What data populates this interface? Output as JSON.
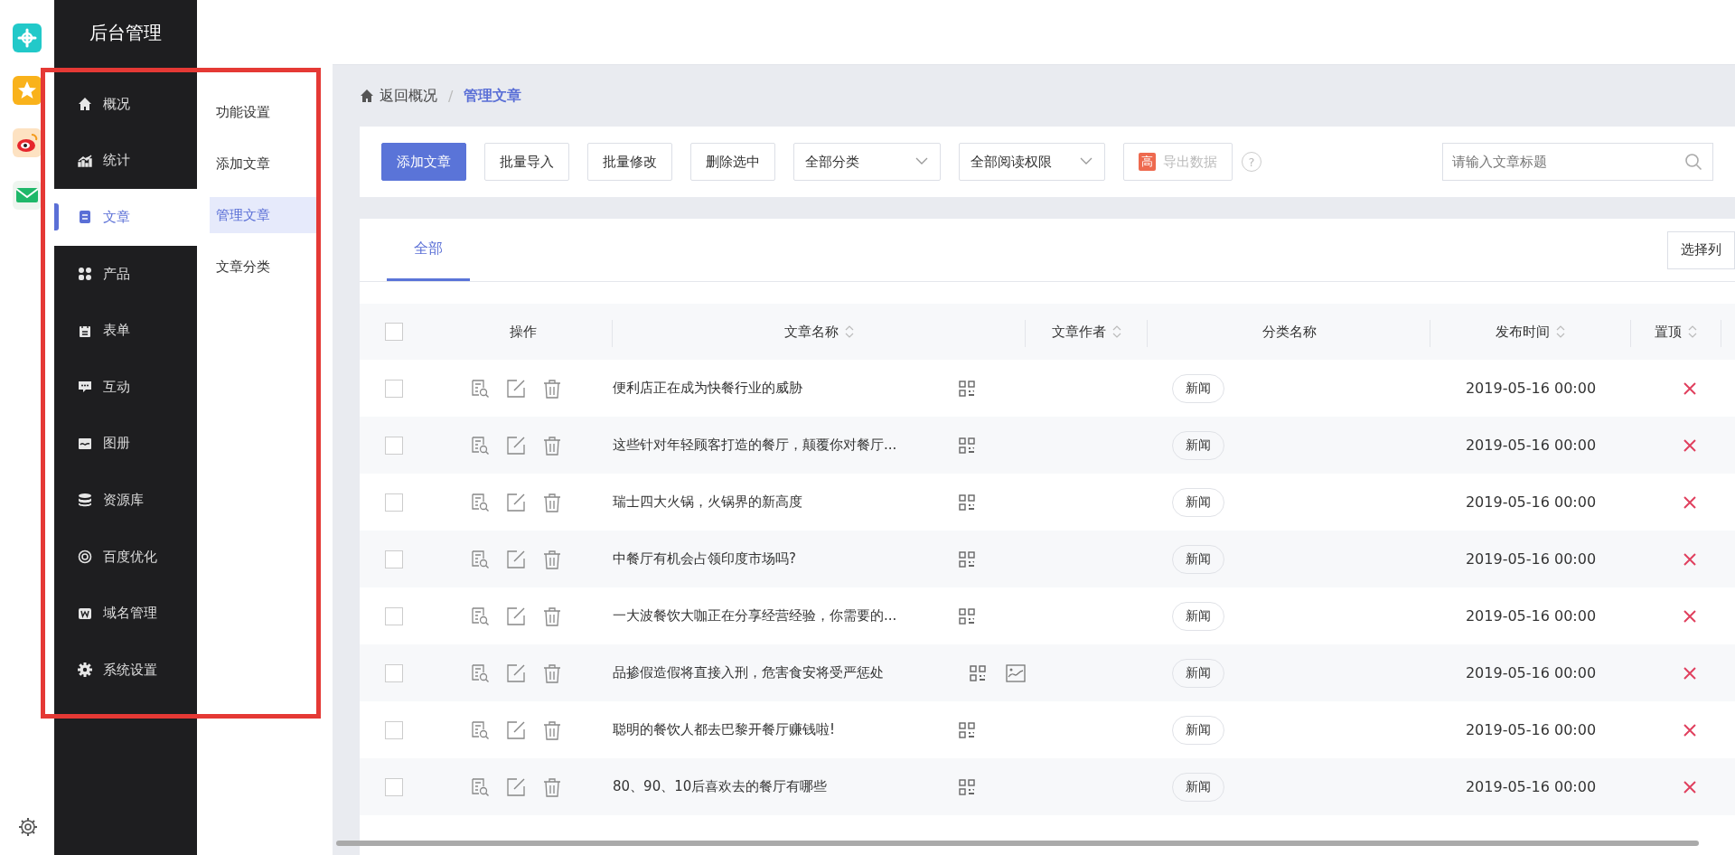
{
  "sidebar": {
    "title": "后台管理",
    "items": [
      {
        "label": "概况",
        "selected": false
      },
      {
        "label": "统计",
        "selected": false
      },
      {
        "label": "文章",
        "selected": true
      },
      {
        "label": "产品",
        "selected": false
      },
      {
        "label": "表单",
        "selected": false
      },
      {
        "label": "互动",
        "selected": false
      },
      {
        "label": "图册",
        "selected": false
      },
      {
        "label": "资源库",
        "selected": false
      },
      {
        "label": "百度优化",
        "selected": false
      },
      {
        "label": "域名管理",
        "selected": false
      },
      {
        "label": "系统设置",
        "selected": false
      }
    ]
  },
  "submenu": [
    {
      "label": "功能设置",
      "selected": false
    },
    {
      "label": "添加文章",
      "selected": false
    },
    {
      "label": "管理文章",
      "selected": true
    },
    {
      "label": "文章分类",
      "selected": false
    }
  ],
  "breadcrumb": {
    "separator": "/",
    "items": [
      {
        "label": "返回概况",
        "current": false
      },
      {
        "label": "管理文章",
        "current": true
      }
    ]
  },
  "toolbar": {
    "controls": [
      {
        "kind": "primary",
        "label": "添加文章"
      },
      {
        "kind": "button",
        "label": "批量导入"
      },
      {
        "kind": "button",
        "label": "批量修改"
      },
      {
        "kind": "button",
        "label": "删除选中"
      },
      {
        "kind": "select",
        "label": "全部分类"
      },
      {
        "kind": "select",
        "label": "全部阅读权限"
      },
      {
        "kind": "export",
        "badge": "高",
        "label": "导出数据",
        "disabled": true
      },
      {
        "kind": "help",
        "label": "?"
      }
    ],
    "search": {
      "placeholder": "请输入文章标题"
    }
  },
  "tabs": [
    {
      "label": "全部",
      "selected": true
    }
  ],
  "choose_columns": "选择列",
  "table": {
    "all_checked": false,
    "columns": [
      {
        "label": "操作",
        "sortable": false
      },
      {
        "label": "文章名称",
        "sortable": true
      },
      {
        "label": "文章作者",
        "sortable": true
      },
      {
        "label": "分类名称",
        "sortable": false
      },
      {
        "label": "发布时间",
        "sortable": true
      },
      {
        "label": "置顶",
        "sortable": true
      }
    ],
    "rows": [
      {
        "checked": false,
        "title": "便利店正在成为快餐行业的威胁",
        "has_image": false,
        "category": "新闻",
        "time": "2019-05-16 00:00",
        "pinned": false
      },
      {
        "checked": false,
        "title": "这些针对年轻顾客打造的餐厅，颠覆你对餐厅...",
        "has_image": false,
        "category": "新闻",
        "time": "2019-05-16 00:00",
        "pinned": false
      },
      {
        "checked": false,
        "title": "瑞士四大火锅，火锅界的新高度",
        "has_image": false,
        "category": "新闻",
        "time": "2019-05-16 00:00",
        "pinned": false
      },
      {
        "checked": false,
        "title": "中餐厅有机会占领印度市场吗?",
        "has_image": false,
        "category": "新闻",
        "time": "2019-05-16 00:00",
        "pinned": false
      },
      {
        "checked": false,
        "title": "一大波餐饮大咖正在分享经营经验，你需要的...",
        "has_image": false,
        "category": "新闻",
        "time": "2019-05-16 00:00",
        "pinned": false
      },
      {
        "checked": false,
        "title": "品掺假造假将直接入刑，危害食安将受严惩处",
        "has_image": true,
        "category": "新闻",
        "time": "2019-05-16 00:00",
        "pinned": false
      },
      {
        "checked": false,
        "title": "聪明的餐饮人都去巴黎开餐厅赚钱啦!",
        "has_image": false,
        "category": "新闻",
        "time": "2019-05-16 00:00",
        "pinned": false
      },
      {
        "checked": false,
        "title": "80、90、10后喜欢去的餐厅有哪些",
        "has_image": false,
        "category": "新闻",
        "time": "2019-05-16 00:00",
        "pinned": false
      }
    ]
  }
}
